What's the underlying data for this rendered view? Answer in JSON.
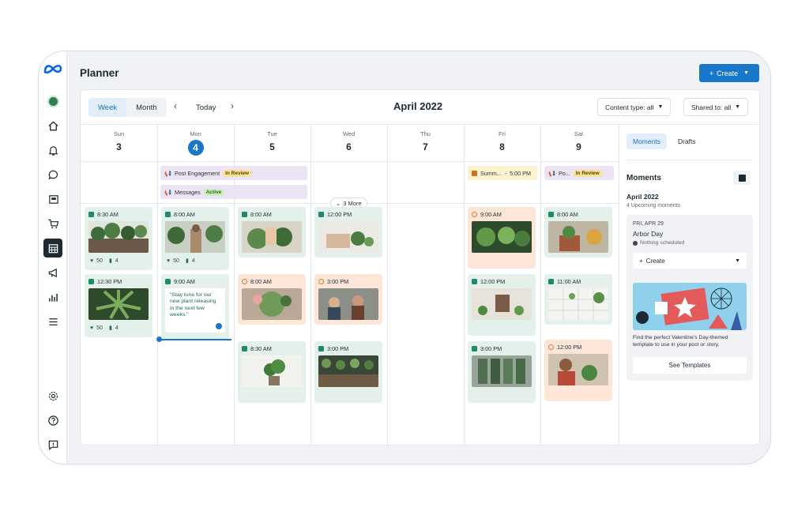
{
  "app": {
    "title": "Planner"
  },
  "header": {
    "create_label": "Create"
  },
  "toolbar": {
    "view_week": "Week",
    "view_month": "Month",
    "today": "Today",
    "month_title": "April 2022",
    "content_filter": "Content type: all",
    "shared_filter": "Shared to: all"
  },
  "days": [
    {
      "name": "Sun",
      "num": "3"
    },
    {
      "name": "Mon",
      "num": "4"
    },
    {
      "name": "Tue",
      "num": "5"
    },
    {
      "name": "Wed",
      "num": "6"
    },
    {
      "name": "Thu",
      "num": "7"
    },
    {
      "name": "Fri",
      "num": "8"
    },
    {
      "name": "Sat",
      "num": "9"
    }
  ],
  "events": {
    "post_engagement": {
      "label": "Post Engagement",
      "badge": "In Review"
    },
    "messages": {
      "label": "Messages",
      "badge": "Active"
    },
    "summer": {
      "label": "Summ...",
      "time": "5:00 PM"
    },
    "sat_event": {
      "label": "Po...",
      "badge": "In Review"
    }
  },
  "more_label": "3 More",
  "posts": {
    "sun1": {
      "time": "8:30 AM",
      "likes": "50",
      "comments": "4"
    },
    "sun2": {
      "time": "12:30 PM",
      "likes": "50",
      "comments": "4"
    },
    "mon1": {
      "time": "8:00 AM",
      "likes": "50",
      "comments": "4"
    },
    "mon2": {
      "time": "9:00 AM",
      "quote": "\"Stay tune for our new plant releasing in the next few weeks.\""
    },
    "tue1": {
      "time": "8:00 AM"
    },
    "tue2": {
      "time": "8:00 AM"
    },
    "tue3": {
      "time": "8:30 AM"
    },
    "wed1": {
      "time": "12:00 PM"
    },
    "wed2": {
      "time": "3:00 PM"
    },
    "wed3": {
      "time": "3:00 PM"
    },
    "fri1": {
      "time": "9:00 AM"
    },
    "fri2": {
      "time": "12:00 PM"
    },
    "fri3": {
      "time": "3:00 PM"
    },
    "sat1": {
      "time": "8:00 AM"
    },
    "sat2": {
      "time": "11:00 AM"
    },
    "sat3": {
      "time": "12:00 PM"
    }
  },
  "sidebar": {
    "tab_moments": "Moments",
    "tab_drafts": "Drafts",
    "moments_title": "Moments",
    "month": "April 2022",
    "upcoming": "4 Upcoming moments",
    "card": {
      "date": "FRI, APR 29",
      "name": "Arbor Day",
      "status": "Nothing scheduled",
      "create_label": "Create",
      "promo_text": "Find the perfect Valentine's Day-themed template to use in your post or story.",
      "button": "See Templates"
    }
  },
  "nav_icons": [
    "avatar-icon",
    "home-icon",
    "bell-icon",
    "chat-icon",
    "posts-icon",
    "cart-icon",
    "planner-icon",
    "megaphone-icon",
    "insights-icon",
    "menu-icon",
    "settings-icon",
    "help-icon",
    "feedback-icon"
  ],
  "colors": {
    "accent": "#1877c9",
    "green_card": "#e3f1ea",
    "orange_card": "#fde6d8"
  }
}
